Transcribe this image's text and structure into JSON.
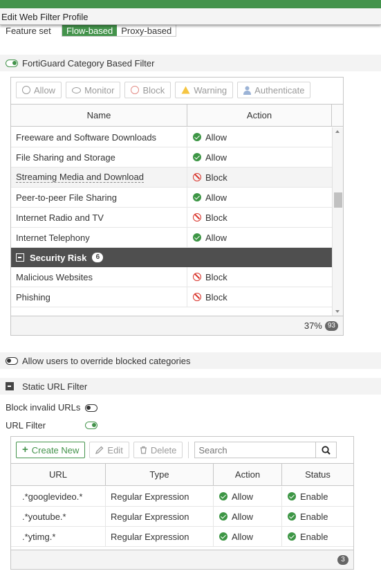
{
  "dialog": {
    "title": "Edit Web Filter Profile"
  },
  "feature_set": {
    "label": "Feature set",
    "options": [
      "Flow-based",
      "Proxy-based"
    ],
    "selected": "Flow-based"
  },
  "fortiguard": {
    "label": "FortiGuard Category Based Filter",
    "enabled": true,
    "actions": [
      "Allow",
      "Monitor",
      "Block",
      "Warning",
      "Authenticate"
    ],
    "columns": [
      "Name",
      "Action"
    ],
    "rows": [
      {
        "name": "Freeware and Software Downloads",
        "action": "Allow"
      },
      {
        "name": "File Sharing and Storage",
        "action": "Allow"
      },
      {
        "name": "Streaming Media and Download",
        "action": "Block"
      },
      {
        "name": "Peer-to-peer File Sharing",
        "action": "Allow"
      },
      {
        "name": "Internet Radio and TV",
        "action": "Block"
      },
      {
        "name": "Internet Telephony",
        "action": "Allow"
      }
    ],
    "group": {
      "name": "Security Risk",
      "count": "6"
    },
    "group_rows": [
      {
        "name": "Malicious Websites",
        "action": "Block"
      },
      {
        "name": "Phishing",
        "action": "Block"
      }
    ],
    "footer": {
      "percent": "37%",
      "total": "93"
    }
  },
  "override": {
    "label": "Allow users to override blocked categories",
    "enabled": false
  },
  "static_url": {
    "label": "Static URL Filter",
    "block_invalid_label": "Block invalid URLs",
    "block_invalid_enabled": false,
    "url_filter_label": "URL Filter",
    "url_filter_enabled": true,
    "toolbar": {
      "create": "Create New",
      "edit": "Edit",
      "delete": "Delete",
      "search_placeholder": "Search"
    },
    "columns": [
      "URL",
      "Type",
      "Action",
      "Status"
    ],
    "rows": [
      {
        "url": ".*googlevideo.*",
        "type": "Regular Expression",
        "action": "Allow",
        "status": "Enable"
      },
      {
        "url": ".*youtube.*",
        "type": "Regular Expression",
        "action": "Allow",
        "status": "Enable"
      },
      {
        "url": ".*ytimg.*",
        "type": "Regular Expression",
        "action": "Allow",
        "status": "Enable"
      }
    ],
    "footer_count": "3"
  }
}
